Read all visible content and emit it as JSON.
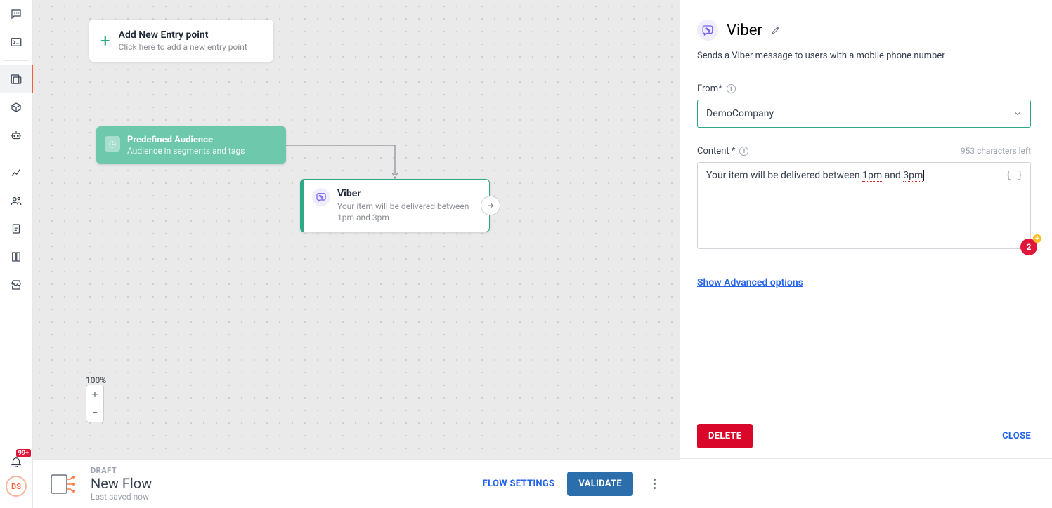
{
  "nav": {
    "notifications_badge": "99+",
    "avatar_initials": "DS"
  },
  "canvas": {
    "entry": {
      "title": "Add New Entry point",
      "subtitle": "Click here to add a new entry point"
    },
    "audience_node": {
      "title": "Predefined Audience",
      "subtitle": "Audience in segments and tags"
    },
    "viber_node": {
      "title": "Viber",
      "subtitle": "Your item will be delivered between 1pm and 3pm"
    },
    "zoom_level": "100%"
  },
  "bottombar": {
    "status": "DRAFT",
    "flow_name": "New Flow",
    "saved_text": "Last saved now",
    "flow_settings_label": "FLOW SETTINGS",
    "validate_label": "VALIDATE"
  },
  "panel": {
    "title": "Viber",
    "description": "Sends a Viber message to users with a mobile phone number",
    "from_label": "From*",
    "from_value": "DemoCompany",
    "content_label": "Content *",
    "char_count_text": "953 characters left",
    "content_text_pre": "Your item will be delivered between ",
    "content_spell1": "1pm",
    "content_text_mid": " and ",
    "content_spell2": "3pm",
    "variable_badge": "2",
    "advanced_link": "Show Advanced options",
    "delete_label": "DELETE",
    "close_label": "CLOSE"
  }
}
